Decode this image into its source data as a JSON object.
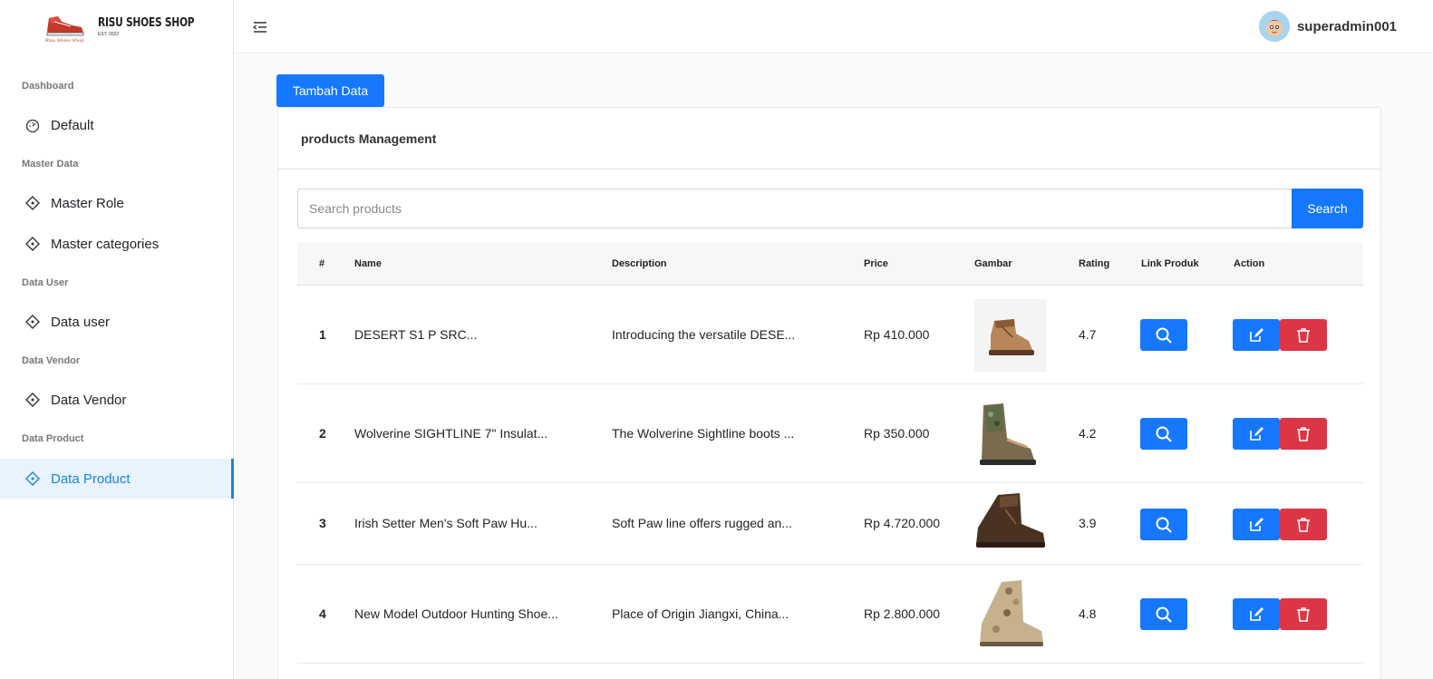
{
  "brand": {
    "name": "RISU SHOES SHOP",
    "est": "EST. 2022"
  },
  "sidebar": {
    "sections": [
      {
        "label": "Dashboard",
        "items": [
          {
            "label": "Default",
            "icon": "dashboard-icon"
          }
        ]
      },
      {
        "label": "Master Data",
        "items": [
          {
            "label": "Master Role",
            "icon": "diamond-icon"
          },
          {
            "label": "Master categories",
            "icon": "diamond-icon"
          }
        ]
      },
      {
        "label": "Data User",
        "items": [
          {
            "label": "Data user",
            "icon": "diamond-icon"
          }
        ]
      },
      {
        "label": "Data Vendor",
        "items": [
          {
            "label": "Data Vendor",
            "icon": "diamond-icon"
          }
        ]
      },
      {
        "label": "Data Product",
        "items": [
          {
            "label": "Data Product",
            "icon": "diamond-icon",
            "active": true
          }
        ]
      }
    ]
  },
  "header": {
    "username": "superadmin001"
  },
  "main": {
    "add_label": "Tambah Data",
    "card_title": "products Management",
    "search": {
      "placeholder": "Search products",
      "button": "Search"
    },
    "table": {
      "columns": [
        "#",
        "Name",
        "Description",
        "Price",
        "Gambar",
        "Rating",
        "Link Produk",
        "Action"
      ],
      "rows": [
        {
          "no": "1",
          "name": "DESERT S1 P SRC...",
          "description": "Introducing the versatile DESE...",
          "price": "Rp 410.000",
          "rating": "4.7"
        },
        {
          "no": "2",
          "name": "Wolverine SIGHTLINE 7\" Insulat...",
          "description": "The Wolverine Sightline boots ...",
          "price": "Rp 350.000",
          "rating": "4.2"
        },
        {
          "no": "3",
          "name": "Irish Setter Men's Soft Paw Hu...",
          "description": "Soft Paw line offers rugged an...",
          "price": "Rp 4.720.000",
          "rating": "3.9"
        },
        {
          "no": "4",
          "name": "New Model Outdoor Hunting Shoe...",
          "description": "Place of Origin Jiangxi, China...",
          "price": "Rp 2.800.000",
          "rating": "4.8"
        }
      ]
    }
  },
  "colors": {
    "primary": "#1677ff",
    "danger": "#dc3545",
    "active_bg": "#e8f3fd",
    "active_fg": "#1a86e0"
  }
}
